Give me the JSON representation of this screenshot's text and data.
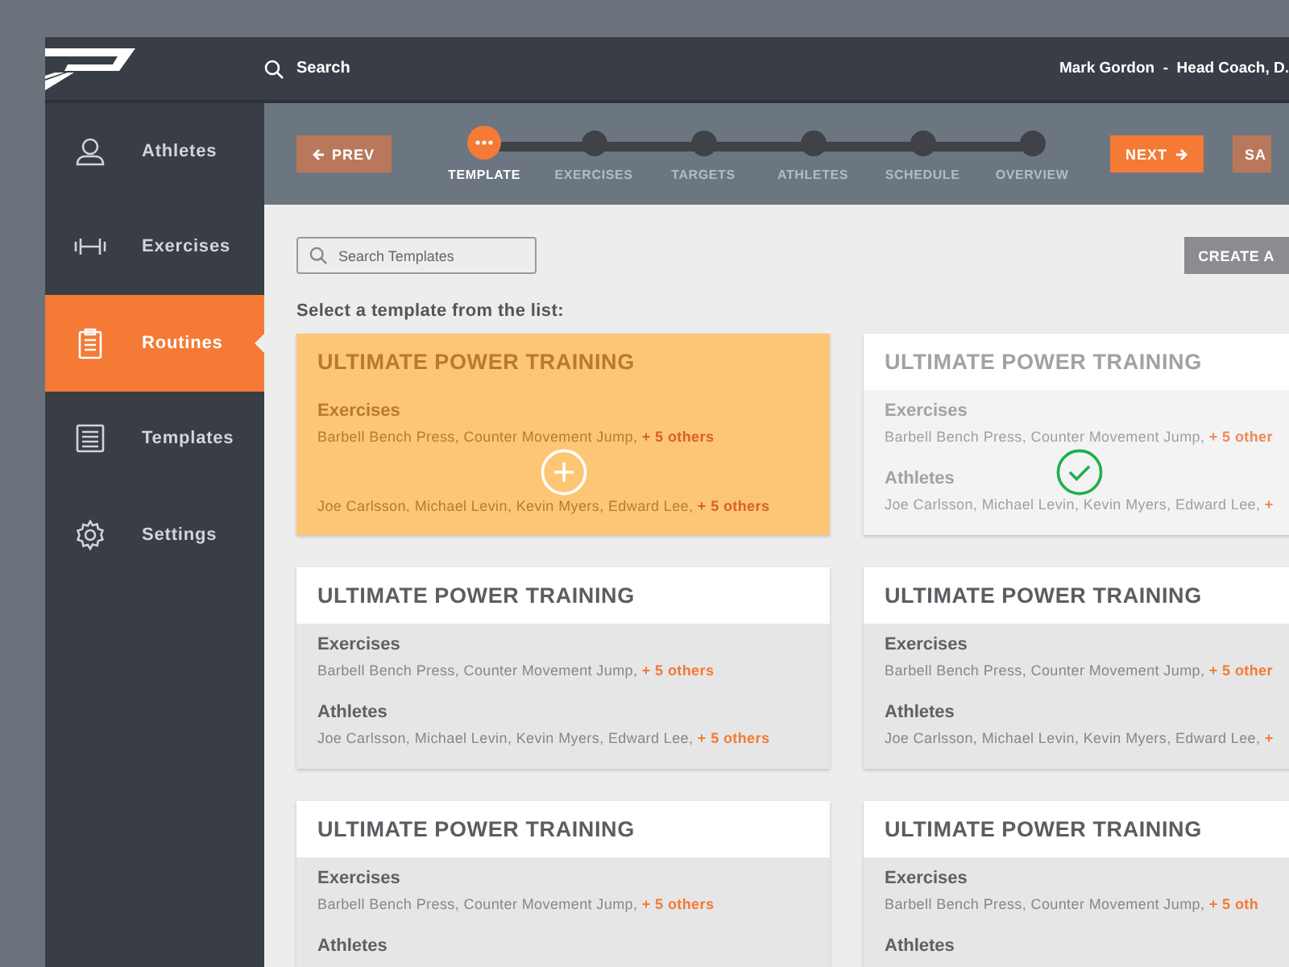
{
  "topbar": {
    "search": "Search",
    "user": "Mark Gordon  -  Head Coach, D."
  },
  "sidebar": {
    "items": [
      {
        "label": "Athletes",
        "selected": false
      },
      {
        "label": "Exercises",
        "selected": false
      },
      {
        "label": "Routines",
        "selected": true
      },
      {
        "label": "Templates",
        "selected": false
      },
      {
        "label": "Settings",
        "selected": false
      }
    ]
  },
  "stepper": {
    "prev": "PREV",
    "next": "NEXT",
    "save": "SA",
    "steps": [
      {
        "label": "TEMPLATE",
        "selected": true
      },
      {
        "label": "EXERCISES",
        "selected": false
      },
      {
        "label": "TARGETS",
        "selected": false
      },
      {
        "label": "ATHLETES",
        "selected": false
      },
      {
        "label": "SCHEDULE",
        "selected": false
      },
      {
        "label": "OVERVIEW",
        "selected": false
      }
    ]
  },
  "search_field": {
    "placeholder": "Search Templates"
  },
  "create_button": "CREATE A",
  "instruction": "Select a template from the list:",
  "cards": [
    {
      "title": "ULTIMATE POWER TRAINING",
      "kind": "hover",
      "sections": [
        {
          "label": "Exercises",
          "names": "Barbell Bench Press, Counter Movement Jump,",
          "more": "+ 5 others"
        },
        {
          "names": "Joe Carlsson, Michael Levin, Kevin Myers, Edward Lee,",
          "more": "+ 5 others"
        }
      ]
    },
    {
      "title": "ULTIMATE POWER TRAINING",
      "kind": "selected",
      "sections": [
        {
          "label": "Exercises",
          "names": "Barbell Bench Press, Counter Movement Jump,",
          "more": "+ 5 other"
        },
        {
          "label": "Athletes",
          "names": "Joe Carlsson, Michael Levin, Kevin Myers, Edward Lee,",
          "more": "+"
        }
      ]
    },
    {
      "title": "ULTIMATE POWER TRAINING",
      "kind": "normal",
      "sections": [
        {
          "label": "Exercises",
          "names": "Barbell Bench Press, Counter Movement Jump,",
          "more": "+ 5 others"
        },
        {
          "label": "Athletes",
          "names": "Joe Carlsson, Michael Levin, Kevin Myers, Edward Lee,",
          "more": "+ 5 others"
        }
      ]
    },
    {
      "title": "ULTIMATE POWER TRAINING",
      "kind": "normal",
      "sections": [
        {
          "label": "Exercises",
          "names": "Barbell Bench Press, Counter Movement Jump,",
          "more": "+ 5 other"
        },
        {
          "label": "Athletes",
          "names": "Joe Carlsson, Michael Levin, Kevin Myers, Edward Lee,",
          "more": "+"
        }
      ]
    },
    {
      "title": "ULTIMATE POWER TRAINING",
      "kind": "normal",
      "sections": [
        {
          "label": "Exercises",
          "names": "Barbell Bench Press, Counter Movement Jump,",
          "more": "+ 5 others"
        },
        {
          "label": "Athletes"
        }
      ]
    },
    {
      "title": "ULTIMATE POWER TRAINING",
      "kind": "normal",
      "sections": [
        {
          "label": "Exercises",
          "names": "Barbell Bench Press, Counter Movement Jump,",
          "more": "+ 5 oth"
        },
        {
          "label": "Athletes"
        }
      ]
    }
  ]
}
